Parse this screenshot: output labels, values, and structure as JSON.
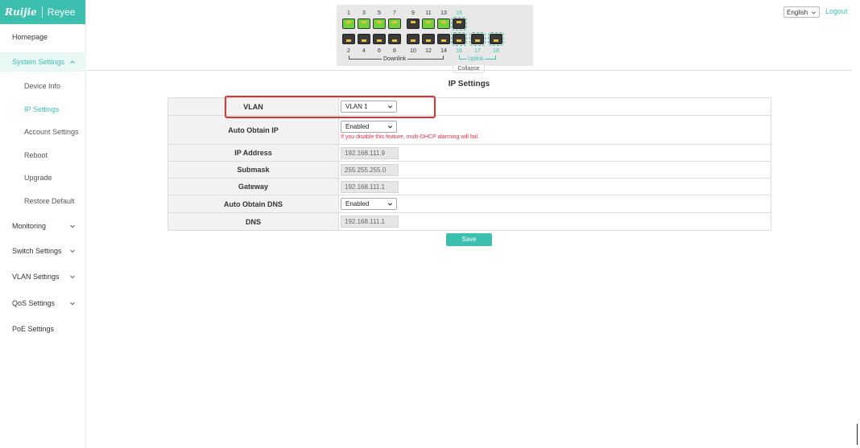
{
  "brand": {
    "left": "Ruijie",
    "right": "Reyee",
    "color": "#3cbfae"
  },
  "sidebar": {
    "items": [
      {
        "label": "Homepage"
      },
      {
        "label": "System Settings",
        "expanded": true
      },
      {
        "label": "Monitoring"
      },
      {
        "label": "Switch Settings"
      },
      {
        "label": "VLAN Settings"
      },
      {
        "label": "QoS Settings"
      },
      {
        "label": "PoE Settings"
      }
    ],
    "subitems": [
      {
        "label": "Device Info"
      },
      {
        "label": "IP Settings",
        "current": true
      },
      {
        "label": "Account Settings"
      },
      {
        "label": "Reboot"
      },
      {
        "label": "Upgrade"
      },
      {
        "label": "Restore Default"
      }
    ]
  },
  "device_panel": {
    "top_ports": [
      "1",
      "3",
      "5",
      "7",
      "9",
      "11",
      "13",
      "15"
    ],
    "bottom_ports": [
      "2",
      "4",
      "6",
      "8",
      "10",
      "12",
      "14",
      "16",
      "17",
      "18"
    ],
    "downlink_label": "Downlink",
    "uplink_label": "Uplink",
    "collapse_label": "Collapse"
  },
  "header": {
    "language": "English",
    "logout": "Logout"
  },
  "page": {
    "title": "IP Settings"
  },
  "form": {
    "vlan": {
      "label": "VLAN",
      "value": "VLAN 1"
    },
    "auto_ip": {
      "label": "Auto Obtain IP",
      "value": "Enabled",
      "warning": "If you disable this feature, multi-DHCP alarming will fail."
    },
    "ip": {
      "label": "IP Address",
      "value": "192.168.111.9"
    },
    "mask": {
      "label": "Submask",
      "value": "255.255.255.0"
    },
    "gateway": {
      "label": "Gateway",
      "value": "192.168.111.1"
    },
    "auto_dns": {
      "label": "Auto Obtain DNS",
      "value": "Enabled"
    },
    "dns": {
      "label": "DNS",
      "value": "192.168.111.1"
    }
  },
  "save_label": "Save"
}
